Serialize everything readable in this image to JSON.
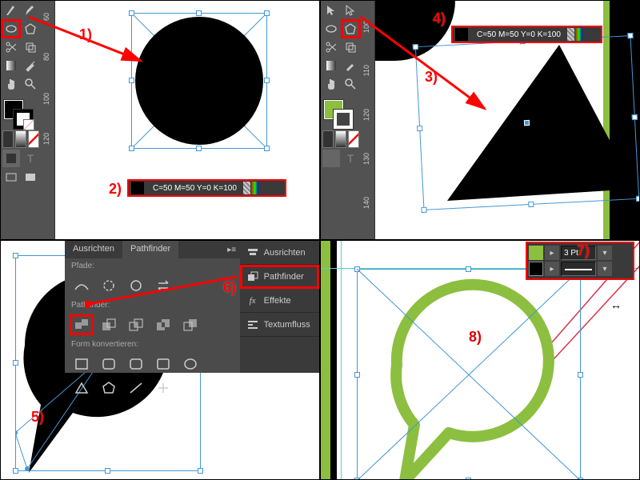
{
  "labels": {
    "n1": "1)",
    "n2": "2)",
    "n3": "3)",
    "n4": "4)",
    "n5": "5)",
    "n6": "6)",
    "n7": "7)",
    "n8": "8)"
  },
  "colorinfo": "C=50 M=50 Y=0 K=100",
  "ruler_q1": [
    "60",
    "80",
    "100",
    "120"
  ],
  "ruler_q2": [
    "100",
    "110",
    "120",
    "130",
    "140"
  ],
  "pathfinder": {
    "tab_align": "Ausrichten",
    "tab_pf": "Pathfinder",
    "sec_paths": "Pfade:",
    "sec_pf": "Pathfinder:",
    "sec_convert": "Form konvertieren:"
  },
  "sidepanel": {
    "align": "Ausrichten",
    "pathfinder": "Pathfinder",
    "effects": "Effekte",
    "textwrap": "Textumfluss"
  },
  "stroke": {
    "value": "3 Pt"
  },
  "colors": {
    "green": "#8cbf3f",
    "black": "#000000",
    "fill_q2": "#8cbf3f"
  }
}
